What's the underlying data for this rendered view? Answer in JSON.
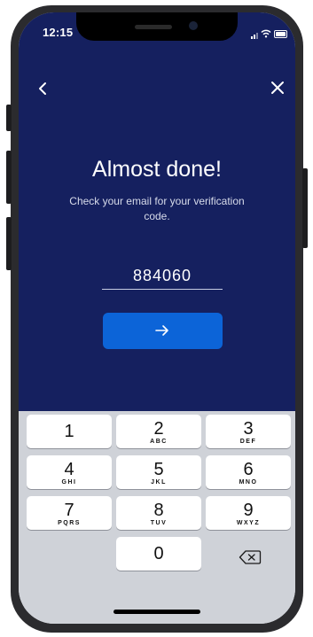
{
  "status_bar": {
    "time": "12:15"
  },
  "nav": {
    "back_icon": "chevron-left-icon",
    "close_icon": "close-icon"
  },
  "main": {
    "title": "Almost done!",
    "subtitle": "Check your email for your verification code.",
    "code_value": "884060",
    "submit_icon": "arrow-right-icon",
    "accent_color": "#0c64d8",
    "background_color": "#15205f"
  },
  "keypad": {
    "keys": [
      {
        "digit": "1",
        "letters": ""
      },
      {
        "digit": "2",
        "letters": "ABC"
      },
      {
        "digit": "3",
        "letters": "DEF"
      },
      {
        "digit": "4",
        "letters": "GHI"
      },
      {
        "digit": "5",
        "letters": "JKL"
      },
      {
        "digit": "6",
        "letters": "MNO"
      },
      {
        "digit": "7",
        "letters": "PQRS"
      },
      {
        "digit": "8",
        "letters": "TUV"
      },
      {
        "digit": "9",
        "letters": "WXYZ"
      },
      {
        "digit": "0",
        "letters": ""
      }
    ],
    "delete_icon": "backspace-icon"
  }
}
